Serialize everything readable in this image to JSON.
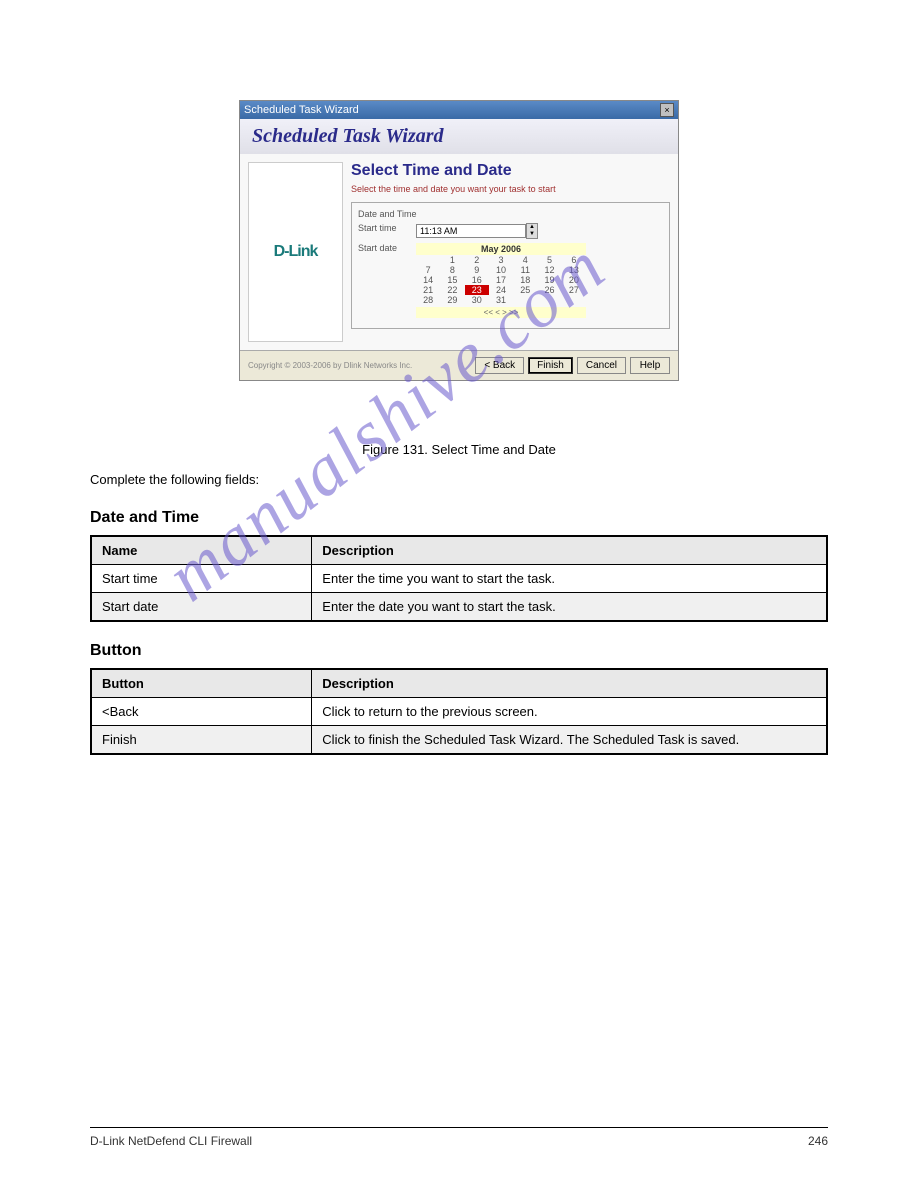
{
  "wizard": {
    "titlebar": "Scheduled Task Wizard",
    "header": "Scheduled Task Wizard",
    "brand": "D-Link",
    "step_title": "Select Time and Date",
    "subtitle": "Select the time and date you want your task to start",
    "fieldset_title": "Date and Time",
    "label_time": "Start time",
    "label_date": "Start date",
    "start_time_value": "11:13 AM",
    "cal_month": "May 2006",
    "cal_days": [
      "",
      "1",
      "2",
      "3",
      "4",
      "5",
      "6",
      "7",
      "8",
      "9",
      "10",
      "11",
      "12",
      "13",
      "14",
      "15",
      "16",
      "17",
      "18",
      "19",
      "20",
      "21",
      "22",
      "23",
      "24",
      "25",
      "26",
      "27",
      "28",
      "29",
      "30",
      "31",
      "",
      "",
      "",
      "",
      "",
      "",
      "",
      "",
      "",
      ""
    ],
    "cal_selected": "23",
    "cal_nav": "<<   <   >   >>",
    "copyright": "Copyright © 2003-2006 by Dlink Networks Inc.",
    "buttons": {
      "back": "< Back",
      "finish": "Finish",
      "cancel": "Cancel",
      "help": "Help"
    }
  },
  "body": {
    "figure_caption": "Figure 131.  Select Time and Date",
    "para1": "Complete the following fields:",
    "table1_title": "Date and Time",
    "table1": {
      "headers": [
        "Name",
        "Description"
      ],
      "rows": [
        [
          "Start time",
          "Enter the time you want to start the task."
        ],
        [
          "Start date",
          "Enter the date you want to start the task."
        ]
      ]
    },
    "table2_title": "Button",
    "table2": {
      "headers": [
        "Button",
        "Description"
      ],
      "rows": [
        [
          "<Back",
          "Click to return to the previous screen."
        ],
        [
          "Finish",
          "Click to finish the Scheduled Task Wizard.  The Scheduled Task is saved."
        ]
      ]
    }
  },
  "footer": {
    "left": "D-Link NetDefend CLI Firewall",
    "right": "246"
  },
  "watermark": "manualshive.com"
}
